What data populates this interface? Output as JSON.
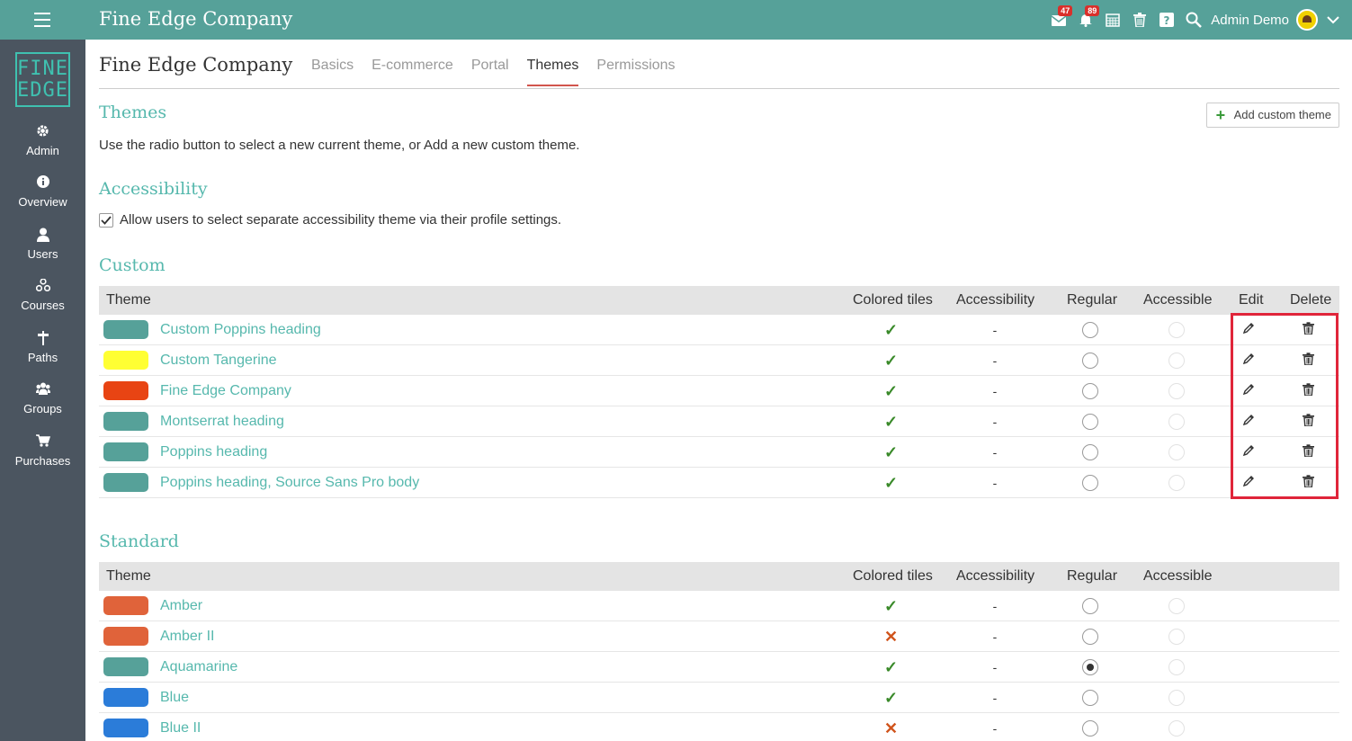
{
  "app": {
    "title": "Fine Edge Company",
    "user_name": "Admin Demo",
    "messages_badge": "47",
    "notifications_badge": "89"
  },
  "logo": {
    "line1": "FINE",
    "line2": "EDGE"
  },
  "sidebar": {
    "items": [
      {
        "label": "Admin",
        "icon": "gear-icon"
      },
      {
        "label": "Overview",
        "icon": "info-icon"
      },
      {
        "label": "Users",
        "icon": "user-icon"
      },
      {
        "label": "Courses",
        "icon": "courses-icon"
      },
      {
        "label": "Paths",
        "icon": "signpost-icon"
      },
      {
        "label": "Groups",
        "icon": "group-icon"
      },
      {
        "label": "Purchases",
        "icon": "cart-icon"
      }
    ]
  },
  "page": {
    "title": "Fine Edge Company",
    "tabs": [
      {
        "label": "Basics"
      },
      {
        "label": "E-commerce"
      },
      {
        "label": "Portal"
      },
      {
        "label": "Themes"
      },
      {
        "label": "Permissions"
      }
    ],
    "active_tab": "Themes"
  },
  "themes_section": {
    "heading": "Themes",
    "description": "Use the radio button to select a new current theme, or Add a new custom theme.",
    "add_button": "Add custom theme"
  },
  "accessibility": {
    "heading": "Accessibility",
    "checkbox_label": "Allow users to select separate accessibility theme via their profile settings.",
    "checked": true
  },
  "custom": {
    "heading": "Custom",
    "columns": {
      "theme": "Theme",
      "colored_tiles": "Colored tiles",
      "accessibility": "Accessibility",
      "regular": "Regular",
      "accessible": "Accessible",
      "edit": "Edit",
      "delete": "Delete"
    },
    "rows": [
      {
        "name": "Custom Poppins heading",
        "color": "#56a199",
        "tiles": "✓",
        "accessibility": "-"
      },
      {
        "name": "Custom Tangerine",
        "color": "#ffff33",
        "tiles": "✓",
        "accessibility": "-"
      },
      {
        "name": "Fine Edge Company",
        "color": "#e84413",
        "tiles": "✓",
        "accessibility": "-"
      },
      {
        "name": "Montserrat heading",
        "color": "#56a199",
        "tiles": "✓",
        "accessibility": "-"
      },
      {
        "name": "Poppins heading",
        "color": "#56a199",
        "tiles": "✓",
        "accessibility": "-"
      },
      {
        "name": "Poppins heading, Source Sans Pro body",
        "color": "#56a199",
        "tiles": "✓",
        "accessibility": "-"
      }
    ]
  },
  "standard": {
    "heading": "Standard",
    "columns": {
      "theme": "Theme",
      "colored_tiles": "Colored tiles",
      "accessibility": "Accessibility",
      "regular": "Regular",
      "accessible": "Accessible"
    },
    "rows": [
      {
        "name": "Amber",
        "color": "#e0633a",
        "tiles": "✓",
        "accessibility": "-",
        "selected": false
      },
      {
        "name": "Amber II",
        "color": "#e0633a",
        "tiles": "✕",
        "accessibility": "-",
        "selected": false
      },
      {
        "name": "Aquamarine",
        "color": "#56a199",
        "tiles": "✓",
        "accessibility": "-",
        "selected": true
      },
      {
        "name": "Blue",
        "color": "#2b7cd9",
        "tiles": "✓",
        "accessibility": "-",
        "selected": false
      },
      {
        "name": "Blue II",
        "color": "#2b7cd9",
        "tiles": "✕",
        "accessibility": "-",
        "selected": false
      }
    ]
  },
  "colors": {
    "topbar": "#56a199",
    "sidebar": "#4b5560",
    "accent": "#56b8ad",
    "check": "#3a8a2a",
    "cross": "#d0541c",
    "highlight": "#e0253a"
  }
}
